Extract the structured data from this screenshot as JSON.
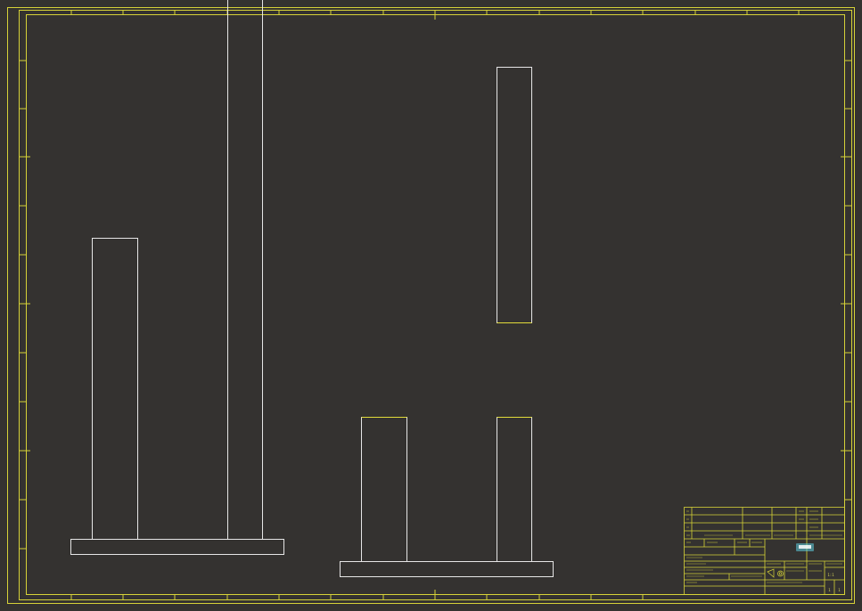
{
  "drawing": {
    "background": "#343230",
    "frame_color": "#d6d238",
    "geometry_white": "#e6e6e6",
    "geometry_yellow": "#e2dc3a",
    "highlight_color": "#5fd0e0"
  },
  "title_block": {
    "logo_icon": "company-logo-icon",
    "symbol_icon": "projection-symbol-icon",
    "scale_label": "1:1",
    "sheet_number": "1",
    "sheet_total": "1"
  }
}
